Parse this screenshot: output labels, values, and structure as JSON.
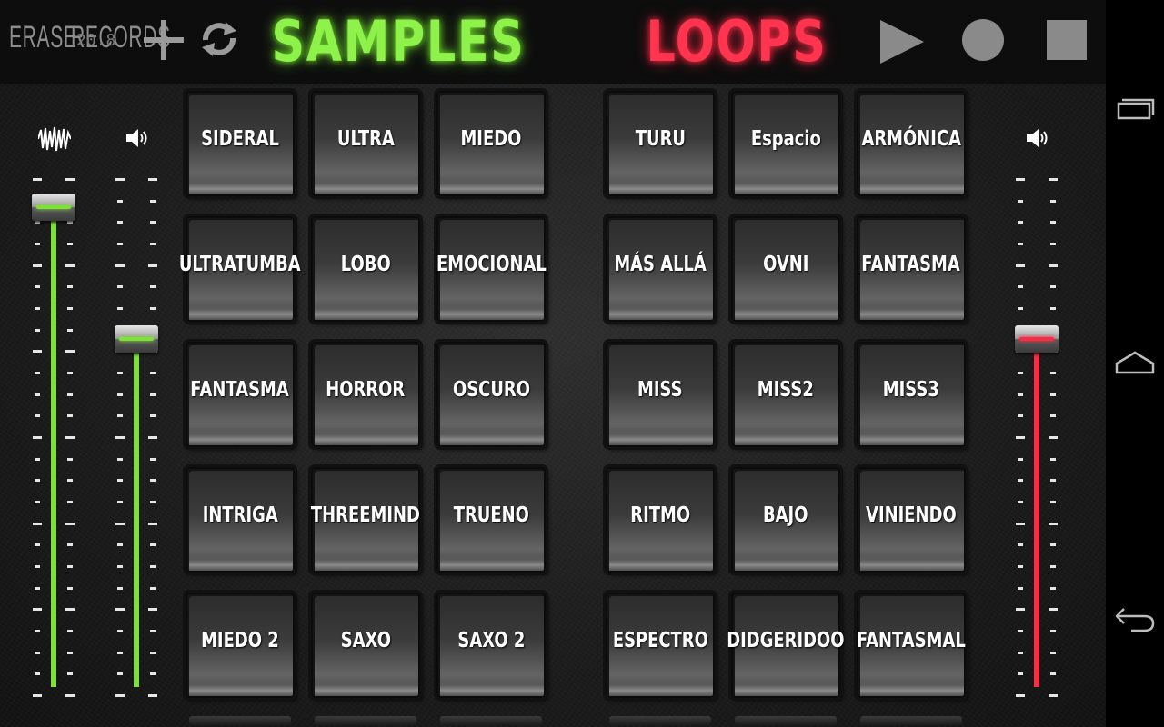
{
  "toolbar": {
    "erase_label": "ERASE",
    "records_label": "RECORDS",
    "records_count": "20.8",
    "add_icon": "plus-icon",
    "refresh_icon": "refresh-icon",
    "play_icon": "play-icon",
    "record_icon": "record-icon",
    "stop_icon": "stop-icon"
  },
  "titles": {
    "samples": "SAMPLES",
    "loops": "LOOPS"
  },
  "colors": {
    "samples_accent": "#8ff24a",
    "loops_accent": "#ff3550",
    "fader_green": "#7fe03a",
    "fader_red": "#ff2a44"
  },
  "faders": {
    "master_wave": {
      "icon": "waveform-icon",
      "level": 0.96
    },
    "samples_volume": {
      "icon": "speaker-icon",
      "level": 0.7
    },
    "loops_volume": {
      "icon": "speaker-icon",
      "level": 0.7
    }
  },
  "samples": [
    [
      "SIDERAL",
      "ULTRA",
      "MIEDO"
    ],
    [
      "ULTRATUMBA",
      "LOBO",
      "EMOCIONAL"
    ],
    [
      "FANTASMA",
      "HORROR",
      "OSCURO"
    ],
    [
      "INTRIGA",
      "THREEMIND",
      "TRUENO"
    ],
    [
      "MIEDO 2",
      "SAXO",
      "SAXO 2"
    ]
  ],
  "loops": [
    [
      "TURU",
      "Espacio",
      "ARMÓNICA"
    ],
    [
      "MÁS ALLÁ",
      "OVNI",
      "FANTASMA"
    ],
    [
      "MISS",
      "MISS2",
      "MISS3"
    ],
    [
      "RITMO",
      "BAJO",
      "VINIENDO"
    ],
    [
      "ESPECTRO",
      "DIDGERIDOO",
      "FANTASMAL"
    ]
  ],
  "navbar": {
    "recents_icon": "recent-apps-icon",
    "home_icon": "home-icon",
    "back_icon": "back-icon"
  }
}
